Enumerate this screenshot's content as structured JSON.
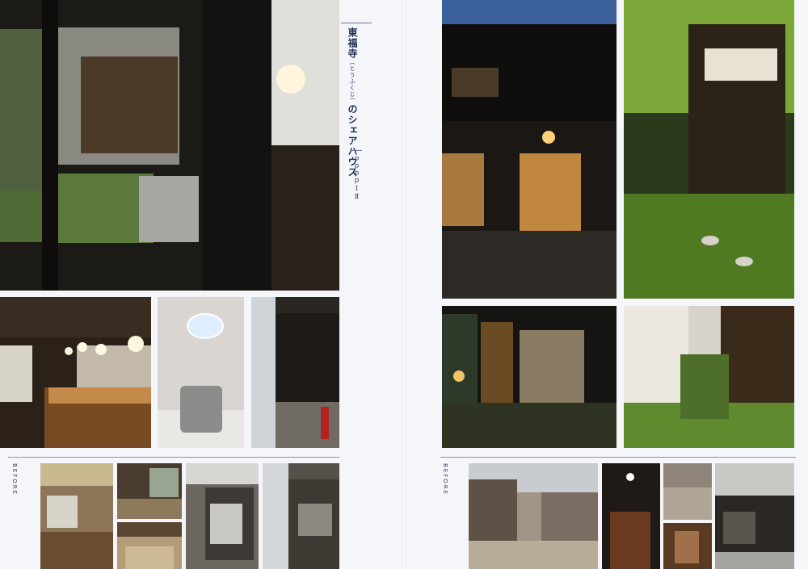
{
  "title": {
    "name": "東福寺",
    "furigana": "（とうふくじ）",
    "suffix": "のシェアハウス",
    "address": "ｐｐｐｐⅠⅡ"
  },
  "left_before_label": "BEFORE",
  "right_before_label": "BEFORE",
  "colors": {
    "background": "#f4f6fa",
    "title_navy": "#1f2f55",
    "rule": "#8a95a8"
  }
}
